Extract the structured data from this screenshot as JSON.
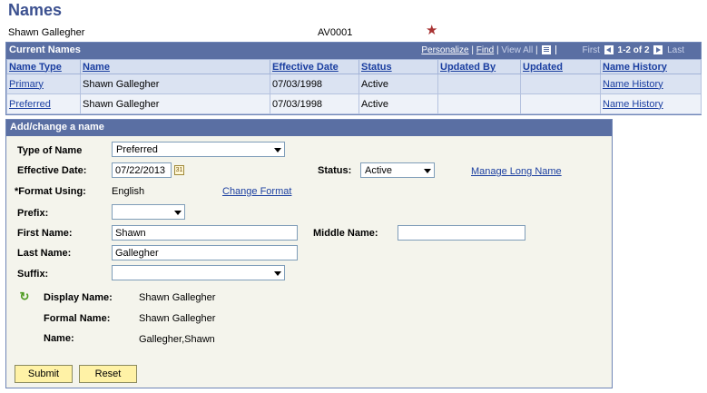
{
  "page": {
    "title": "Names"
  },
  "person": {
    "name": "Shawn Gallegher",
    "id": "AV0001"
  },
  "current_names": {
    "title": "Current Names",
    "nav": {
      "personalize": "Personalize",
      "find": "Find",
      "view_all": "View All",
      "first": "First",
      "range": "1-2 of 2",
      "last": "Last"
    },
    "columns": [
      "Name Type",
      "Name",
      "Effective Date",
      "Status",
      "Updated By",
      "Updated",
      "Name History"
    ],
    "rows": [
      {
        "name_type": "Primary",
        "name": "Shawn Gallegher",
        "effective_date": "07/03/1998",
        "status": "Active",
        "updated_by": "",
        "updated": "",
        "history": "Name History"
      },
      {
        "name_type": "Preferred",
        "name": "Shawn Gallegher",
        "effective_date": "07/03/1998",
        "status": "Active",
        "updated_by": "",
        "updated": "",
        "history": "Name History"
      }
    ]
  },
  "form": {
    "title": "Add/change a name",
    "type_of_name": {
      "label": "Type of Name",
      "value": "Preferred"
    },
    "effective_date": {
      "label": "Effective Date:",
      "value": "07/22/2013"
    },
    "status": {
      "label": "Status:",
      "value": "Active"
    },
    "manage_long_name": "Manage Long Name",
    "format_using": {
      "label": "*Format Using:",
      "value": "English"
    },
    "change_format": "Change Format",
    "prefix": {
      "label": "Prefix:",
      "value": ""
    },
    "first_name": {
      "label": "First Name:",
      "value": "Shawn"
    },
    "middle_name": {
      "label": "Middle Name:",
      "value": ""
    },
    "last_name": {
      "label": "Last Name:",
      "value": "Gallegher"
    },
    "suffix": {
      "label": "Suffix:",
      "value": ""
    },
    "display_name": {
      "label": "Display Name:",
      "value": "Shawn Gallegher"
    },
    "formal_name": {
      "label": "Formal Name:",
      "value": "Shawn Gallegher"
    },
    "name": {
      "label": "Name:",
      "value": "Gallegher,Shawn"
    },
    "submit": "Submit",
    "reset": "Reset"
  },
  "icons": {
    "favorite": "star-icon",
    "refresh": "refresh-icon",
    "calendar": "calendar-icon",
    "download": "download-icon",
    "view_grid": "grid-icon"
  },
  "colors": {
    "header_blue": "#5a6fa3",
    "title": "#3c5190",
    "link": "#1a3ea0",
    "button": "#fff2a6",
    "panel_bg": "#f4f4ec"
  }
}
